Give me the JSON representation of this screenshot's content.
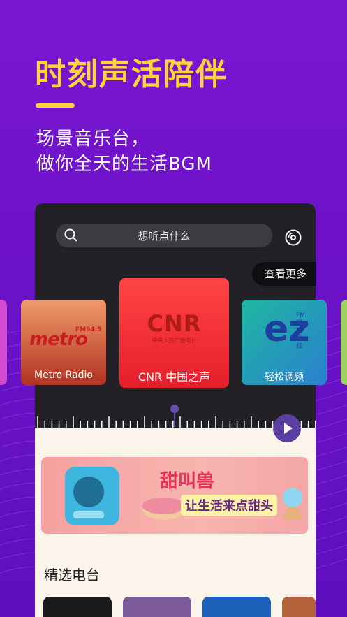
{
  "headline": "时刻声活陪伴",
  "subtitle_line1": "场景音乐台，",
  "subtitle_line2": "做你全天的生活BGM",
  "search": {
    "placeholder": "想听点什么"
  },
  "more_label": "查看更多",
  "stations": [
    {
      "name": "Metro Radio",
      "logo": "metro",
      "logo_sub": "FM94.5"
    },
    {
      "name": "CNR 中国之声",
      "logo": "CNR",
      "logo_sub": "中央人民广播电台"
    },
    {
      "name": "轻松调频",
      "logo": "ez",
      "logo_sub": "FM 轻松调频"
    }
  ],
  "banner": {
    "title": "甜叫兽",
    "slogan": "让生活来点甜头"
  },
  "section_title": "精选电台",
  "colors": {
    "accent": "#ffd43a",
    "bg": "#6d12c8",
    "cnr_red": "#ff3b3b",
    "play": "#5b3fa0"
  }
}
